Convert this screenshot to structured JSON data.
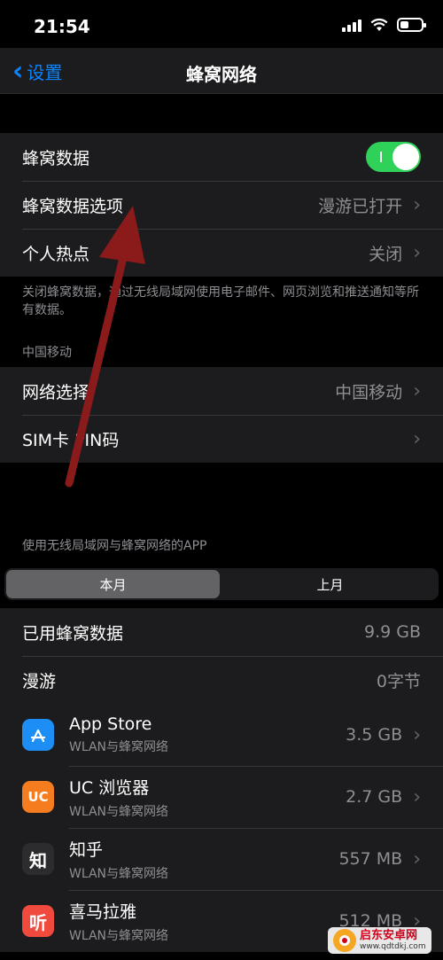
{
  "status": {
    "time": "21:54"
  },
  "nav": {
    "back_label": "设置",
    "title": "蜂窝网络"
  },
  "group1": {
    "cellular_data": {
      "label": "蜂窝数据",
      "enabled": true
    },
    "cellular_options": {
      "label": "蜂窝数据选项",
      "value": "漫游已打开"
    },
    "hotspot": {
      "label": "个人热点",
      "value": "关闭"
    }
  },
  "note": "关闭蜂窝数据，通过无线局域网使用电子邮件、网页浏览和推送通知等所有数据。",
  "carrier_header": "中国移动",
  "group2": {
    "network_select": {
      "label": "网络选择",
      "value": "中国移动"
    },
    "sim_pin": {
      "label": "SIM卡 PIN码"
    }
  },
  "apps_header": "使用无线局域网与蜂窝网络的APP",
  "segments": {
    "current": "本月",
    "last": "上月"
  },
  "usage": {
    "used": {
      "label": "已用蜂窝数据",
      "value": "9.9 GB"
    },
    "roaming": {
      "label": "漫游",
      "value": "0字节"
    }
  },
  "apps": [
    {
      "name": "App Store",
      "sub": "WLAN与蜂窝网络",
      "size": "3.5 GB",
      "icon": "app-store-icon",
      "color": "#1e8ef7",
      "glyph": "A"
    },
    {
      "name": "UC 浏览器",
      "sub": "WLAN与蜂窝网络",
      "size": "2.7 GB",
      "icon": "uc-browser-icon",
      "color": "#f57c1f",
      "glyph": "UC"
    },
    {
      "name": "知乎",
      "sub": "WLAN与蜂窝网络",
      "size": "557 MB",
      "icon": "zhihu-icon",
      "color": "#1c1c1e",
      "glyph": "知"
    },
    {
      "name": "喜马拉雅",
      "sub": "WLAN与蜂窝网络",
      "size": "512 MB",
      "icon": "ximalaya-icon",
      "color": "#f04a3f",
      "glyph": "听"
    }
  ],
  "watermark": {
    "name": "启东安卓网",
    "url": "www.qdtdkj.com"
  }
}
